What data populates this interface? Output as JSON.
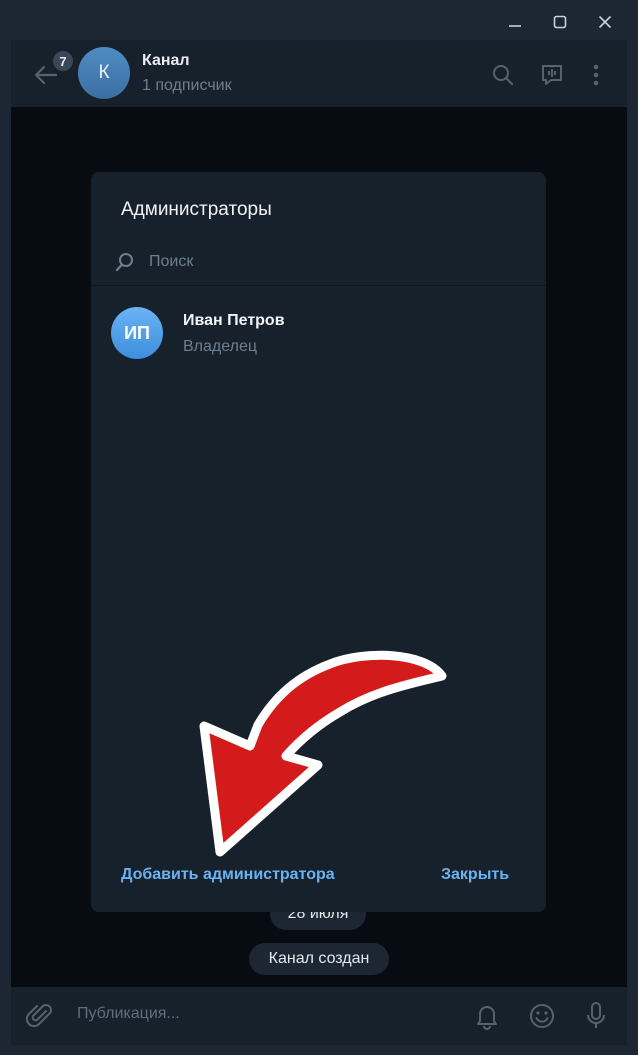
{
  "window": {
    "minimize_icon": "minimize-icon",
    "maximize_icon": "maximize-icon",
    "close_icon": "close-icon"
  },
  "header": {
    "unread_count": "7",
    "channel_initial": "К",
    "channel_title": "Канал",
    "subscribers": "1 подписчик"
  },
  "chat": {
    "date_label": "28 июля",
    "service_message": "Канал создан"
  },
  "composer": {
    "placeholder": "Публикация..."
  },
  "modal": {
    "title": "Администраторы",
    "search_placeholder": "Поиск",
    "admins": [
      {
        "initials": "ИП",
        "name": "Иван Петров",
        "role": "Владелец"
      }
    ],
    "add_admin_label": "Добавить администратора",
    "close_label": "Закрыть"
  },
  "colors": {
    "accent": "#6ab3f3",
    "panel": "#17212b",
    "background": "#0e1621",
    "annotation_arrow": "#d41b1b"
  }
}
